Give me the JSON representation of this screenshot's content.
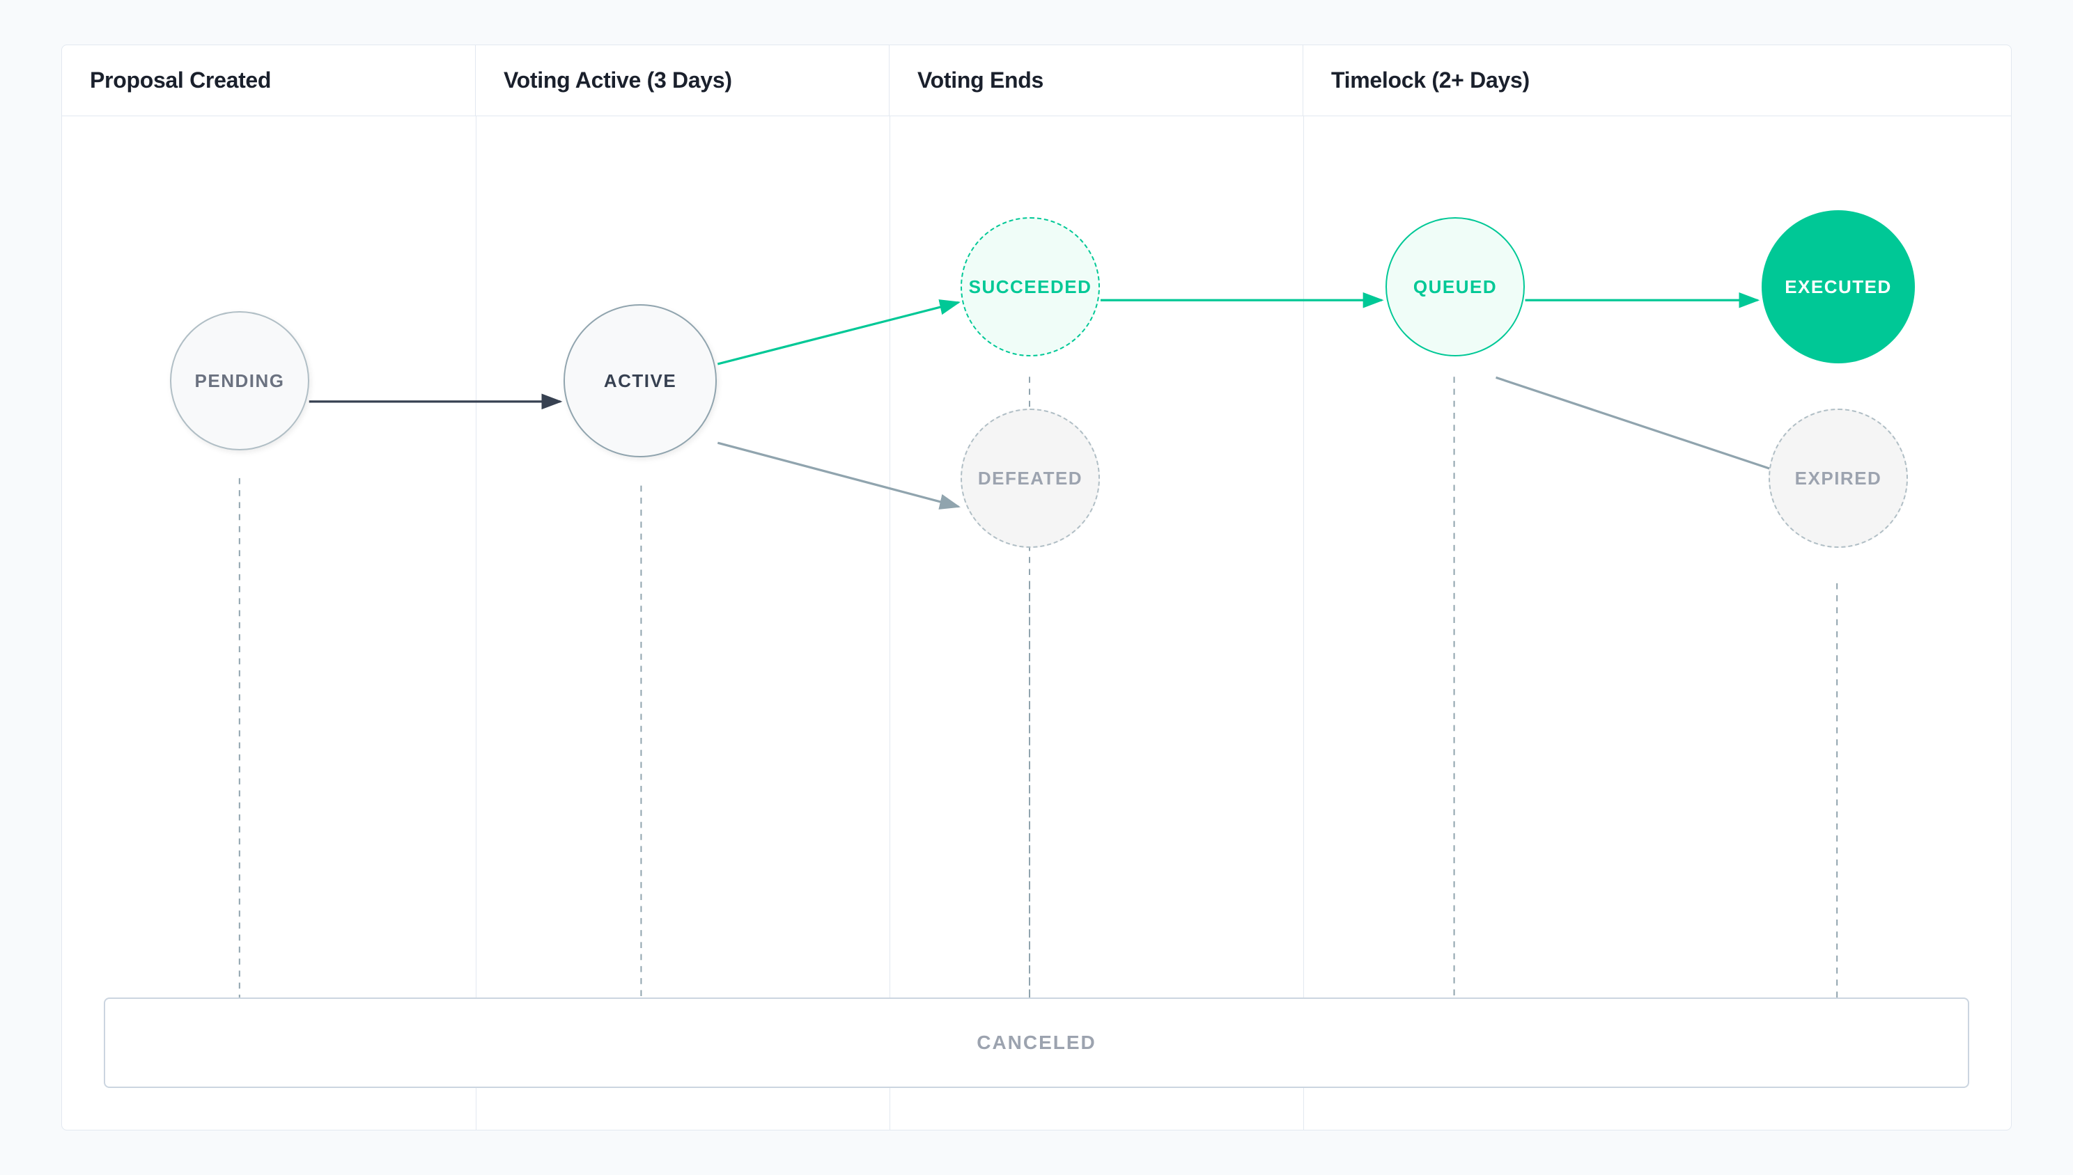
{
  "header": {
    "col1": "Proposal Created",
    "col2": "Voting Active (3 Days)",
    "col3": "Voting Ends",
    "col4": "Timelock (2+ Days)"
  },
  "nodes": {
    "pending": "PENDING",
    "active": "ACTIVE",
    "succeeded": "SUCCEEDED",
    "defeated": "DEFEATED",
    "queued": "QUEUED",
    "executed": "EXECUTED",
    "expired": "EXPIRED"
  },
  "bottom": {
    "canceled": "CANCELED"
  },
  "colors": {
    "green": "#00c896",
    "gray_border": "#b0bec5",
    "dark_text": "#374151",
    "light_text": "#9ca3af"
  }
}
